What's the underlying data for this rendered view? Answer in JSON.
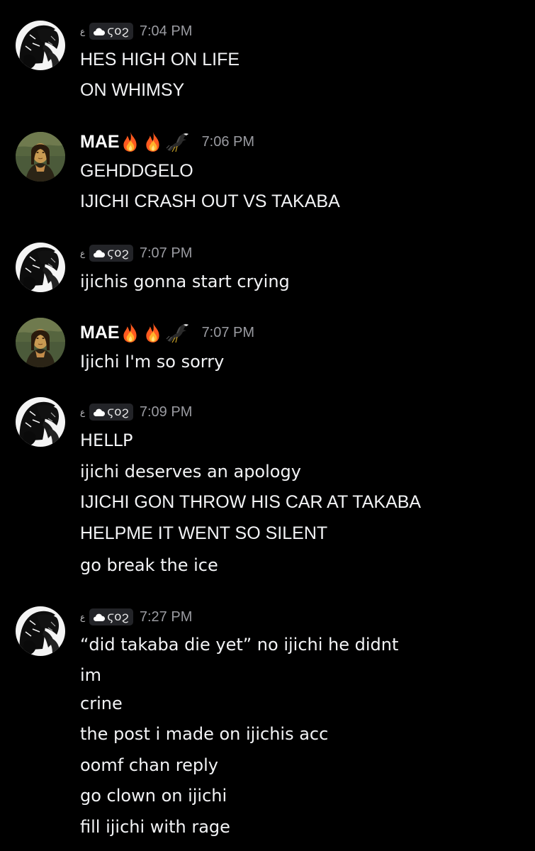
{
  "users": {
    "cloud_user": {
      "prefix": "ع",
      "tag": "ϛoϩ",
      "icon": "cloud-heart-icon"
    },
    "mae": {
      "name": "MAE",
      "emoji": [
        "fire-emoji",
        "fire-emoji",
        "bird-emoji"
      ]
    }
  },
  "colors": {
    "background": "#000000",
    "message_text": "#f2f3f5",
    "timestamp": "#9a9ba1",
    "tag_pill": "#232428"
  },
  "messages": [
    {
      "author": "cloud_user",
      "time": "7:04 PM",
      "lines": [
        "HES HIGH ON LIFE",
        "ON WHIMSY"
      ]
    },
    {
      "author": "mae",
      "time": "7:06 PM",
      "lines": [
        "GEHDDGELO",
        "IJICHI CRASH OUT VS TAKABA"
      ]
    },
    {
      "author": "cloud_user",
      "time": "7:07 PM",
      "lines": [
        "ijichis gonna start crying"
      ]
    },
    {
      "author": "mae",
      "time": "7:07 PM",
      "lines": [
        "Ijichi I'm so sorry"
      ]
    },
    {
      "author": "cloud_user",
      "time": "7:09 PM",
      "lines": [
        "HELLP",
        "ijichi deserves an apology",
        "IJICHI GON THROW HIS CAR AT TAKABA",
        "HELPME IT WENT SO SILENT",
        "go break the ice"
      ]
    },
    {
      "author": "cloud_user",
      "time": "7:27 PM",
      "lines": [
        "“did takaba die yet” no ijichi he didnt",
        "im",
        "crine",
        "the post i made on ijichis acc",
        "oomf chan reply",
        "go clown on ijichi",
        "fill ijichi with rage"
      ]
    }
  ]
}
